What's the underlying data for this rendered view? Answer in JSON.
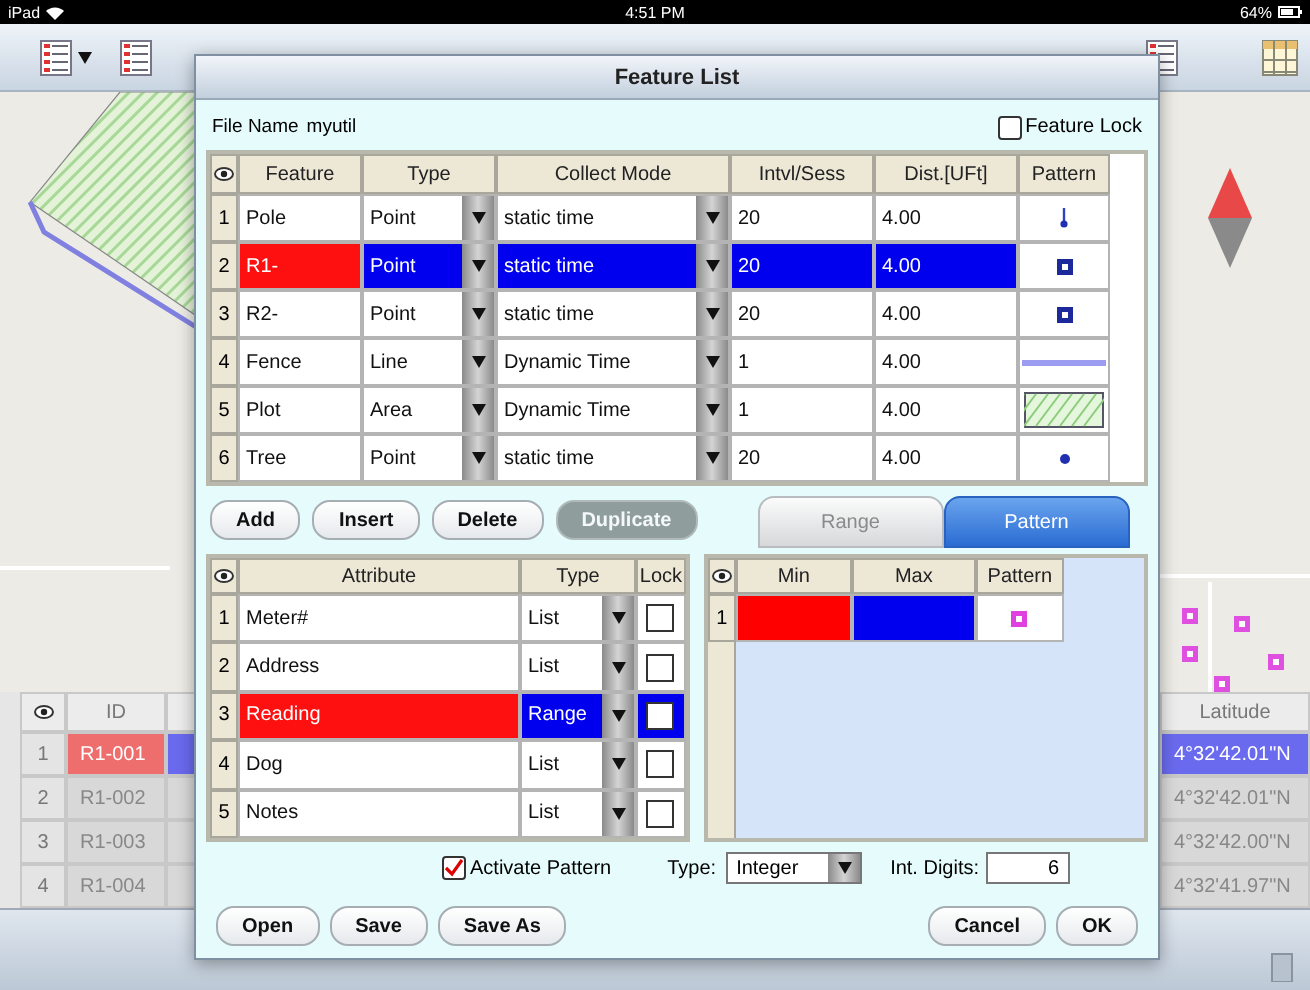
{
  "status_bar": {
    "device": "iPad",
    "time": "4:51 PM",
    "battery": "64%"
  },
  "data_table": {
    "columns": [
      "ID",
      "Latitude"
    ],
    "rows": [
      {
        "index": "1",
        "id": "R1-001",
        "latitude": "4°32'42.01\"N",
        "selected": true
      },
      {
        "index": "2",
        "id": "R1-002",
        "latitude": "4°32'42.01\"N",
        "selected": false
      },
      {
        "index": "3",
        "id": "R1-003",
        "latitude": "4°32'42.00\"N",
        "selected": false
      },
      {
        "index": "4",
        "id": "R1-004",
        "latitude": "4°32'41.97\"N",
        "selected": false
      }
    ]
  },
  "dialog": {
    "title": "Feature List",
    "file_name_label": "File Name",
    "file_name": "myutil",
    "feature_lock": {
      "label": "Feature Lock",
      "checked": false
    },
    "feature_table": {
      "columns": [
        "Feature",
        "Type",
        "Collect Mode",
        "Intvl/Sess",
        "Dist.[UFt]",
        "Pattern"
      ],
      "rows": [
        {
          "index": "1",
          "feature": "Pole",
          "type": "Point",
          "collect_mode": "static time",
          "interval": "20",
          "distance": "4.00",
          "pattern": {
            "kind": "pin"
          },
          "selected": false
        },
        {
          "index": "2",
          "feature": "R1-",
          "type": "Point",
          "collect_mode": "static time",
          "interval": "20",
          "distance": "4.00",
          "pattern": {
            "kind": "square"
          },
          "selected": true
        },
        {
          "index": "3",
          "feature": "R2-",
          "type": "Point",
          "collect_mode": "static time",
          "interval": "20",
          "distance": "4.00",
          "pattern": {
            "kind": "square"
          },
          "selected": false
        },
        {
          "index": "4",
          "feature": "Fence",
          "type": "Line",
          "collect_mode": "Dynamic Time",
          "interval": "1",
          "distance": "4.00",
          "pattern": {
            "kind": "line"
          },
          "selected": false
        },
        {
          "index": "5",
          "feature": "Plot",
          "type": "Area",
          "collect_mode": "Dynamic Time",
          "interval": "1",
          "distance": "4.00",
          "pattern": {
            "kind": "hatch"
          },
          "selected": false
        },
        {
          "index": "6",
          "feature": "Tree",
          "type": "Point",
          "collect_mode": "static time",
          "interval": "20",
          "distance": "4.00",
          "pattern": {
            "kind": "dot"
          },
          "selected": false
        }
      ]
    },
    "feature_buttons": [
      {
        "label": "Add",
        "disabled": false
      },
      {
        "label": "Insert",
        "disabled": false
      },
      {
        "label": "Delete",
        "disabled": false
      },
      {
        "label": "Duplicate",
        "disabled": true
      }
    ],
    "attribute_table": {
      "columns": [
        "Attribute",
        "Type",
        "Lock"
      ],
      "rows": [
        {
          "index": "1",
          "attribute": "Meter#",
          "type": "List",
          "lock": false,
          "selected": false
        },
        {
          "index": "2",
          "attribute": "Address",
          "type": "List",
          "lock": false,
          "selected": false
        },
        {
          "index": "3",
          "attribute": "Reading",
          "type": "Range",
          "lock": false,
          "selected": true
        },
        {
          "index": "4",
          "attribute": "Dog",
          "type": "List",
          "lock": false,
          "selected": false
        },
        {
          "index": "5",
          "attribute": "Notes",
          "type": "List",
          "lock": false,
          "selected": false
        }
      ]
    },
    "mode_tabs": [
      {
        "label": "Range",
        "selected": false
      },
      {
        "label": "Pattern",
        "selected": true
      }
    ],
    "range_table": {
      "columns": [
        "Min",
        "Max",
        "Pattern"
      ],
      "rows": [
        {
          "index": "1",
          "min": {
            "color": "#ff0000"
          },
          "max": {
            "color": "#0000ee"
          },
          "pattern": {
            "kind": "magenta-square"
          }
        }
      ]
    },
    "activate_pattern": {
      "label": "Activate Pattern",
      "checked": true
    },
    "type_select": {
      "label": "Type:",
      "value": "Integer"
    },
    "int_digits": {
      "label": "Int. Digits:",
      "value": "6"
    },
    "left_buttons": [
      "Open",
      "Save",
      "Save As"
    ],
    "right_buttons": [
      "Cancel",
      "OK"
    ]
  }
}
